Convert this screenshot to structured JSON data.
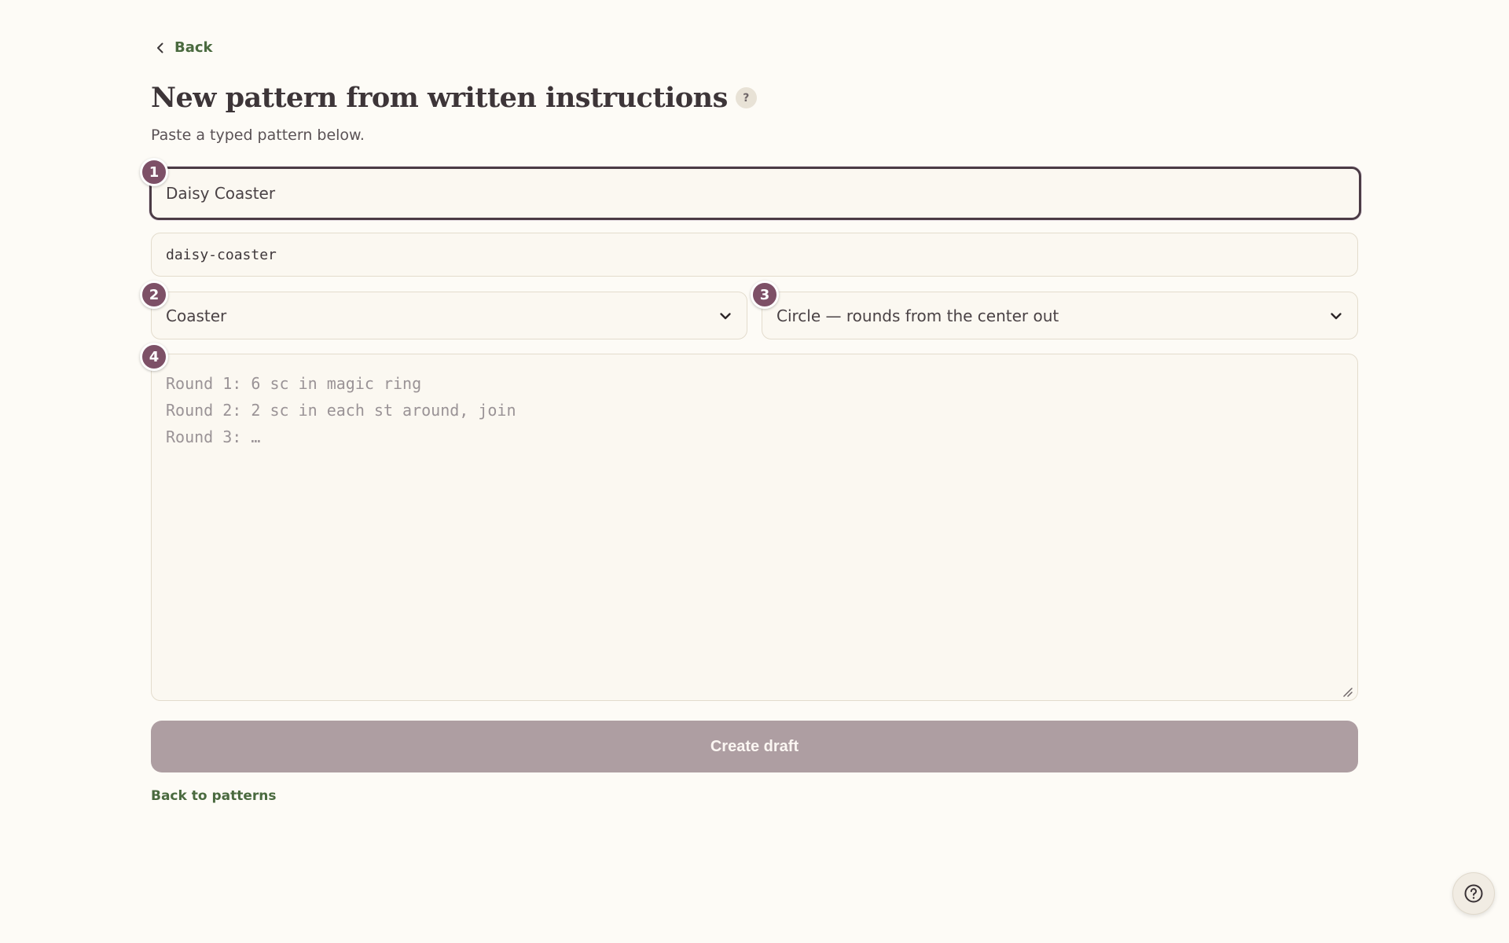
{
  "nav": {
    "back_label": "Back"
  },
  "header": {
    "title": "New pattern from written instructions",
    "help_badge": "?",
    "subtitle": "Paste a typed pattern below."
  },
  "form": {
    "name_value": "Daisy Coaster",
    "slug_value": "daisy-coaster",
    "type_select_value": "Coaster",
    "shape_select_value": "Circle — rounds from the center out",
    "instructions_placeholder_lines": [
      "Round 1: 6 sc in magic ring",
      "Round 2: 2 sc in each st around, join",
      "Round 3: …"
    ],
    "submit_label": "Create draft"
  },
  "steps": [
    "1",
    "2",
    "3",
    "4"
  ],
  "footer": {
    "patterns_link": "Back to patterns"
  },
  "colors": {
    "background": "#fdfbf6",
    "accent": "#7d5067",
    "link": "#4a6a3f",
    "button_disabled": "#ae9ea2"
  },
  "icons": {
    "back": "chevron-left-icon",
    "select": "chevron-down-icon",
    "resize": "resize-handle-icon",
    "help": "question-circle-icon"
  }
}
